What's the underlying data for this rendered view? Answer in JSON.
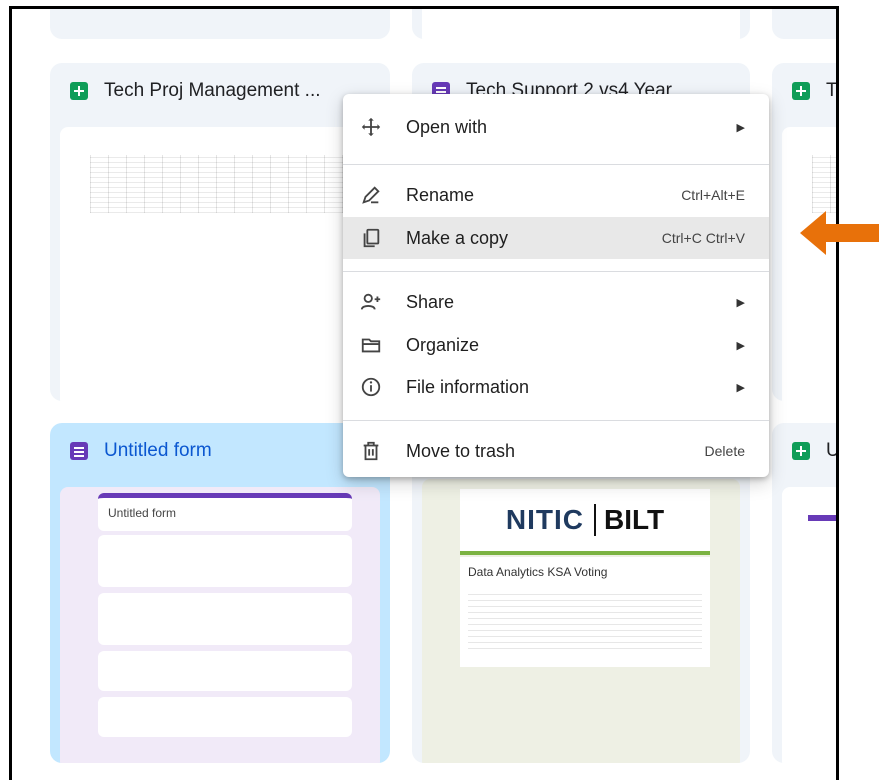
{
  "cards": {
    "tech_proj": {
      "title": "Tech Proj Management ..."
    },
    "tech_support": {
      "title": "Tech Support 2 vs4 Year"
    },
    "right_top": {
      "title": "T"
    },
    "untitled_form": {
      "title": "Untitled form",
      "thumb_title": "Untitled form"
    },
    "nitic": {
      "logo_left": "NITIC",
      "logo_right": "BILT",
      "thumb_title": "Data Analytics KSA Voting"
    },
    "right_bottom": {
      "title": "U"
    }
  },
  "menu": {
    "items": [
      {
        "label": "Open with",
        "shortcut": "",
        "submenu": true,
        "icon": "open-with-icon"
      },
      {
        "label": "Rename",
        "shortcut": "Ctrl+Alt+E",
        "submenu": false,
        "icon": "pencil-icon"
      },
      {
        "label": "Make a copy",
        "shortcut": "Ctrl+C Ctrl+V",
        "submenu": false,
        "icon": "copy-icon",
        "highlighted": true
      },
      {
        "label": "Share",
        "shortcut": "",
        "submenu": true,
        "icon": "person-add-icon"
      },
      {
        "label": "Organize",
        "shortcut": "",
        "submenu": true,
        "icon": "folder-icon"
      },
      {
        "label": "File information",
        "shortcut": "",
        "submenu": true,
        "icon": "info-icon"
      },
      {
        "label": "Move to trash",
        "shortcut": "Delete",
        "submenu": false,
        "icon": "trash-icon"
      }
    ]
  },
  "colors": {
    "sheets": "#0f9d58",
    "forms": "#673ab7",
    "selected_card": "#c2e7ff",
    "pointer_arrow": "#e8710a"
  }
}
